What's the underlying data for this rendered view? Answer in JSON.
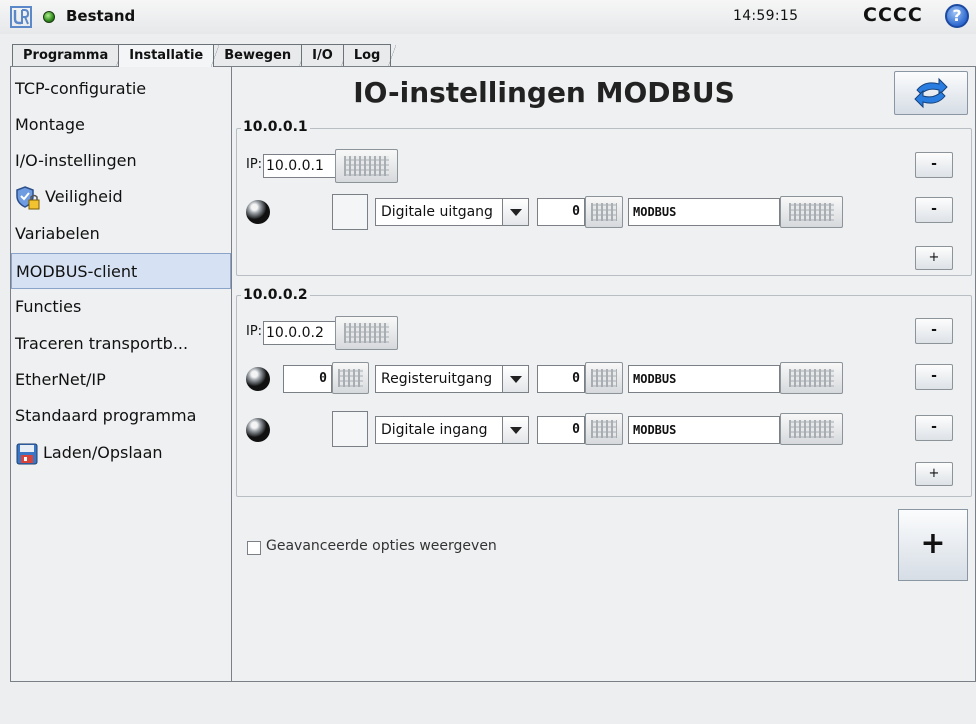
{
  "topbar": {
    "file_menu": "Bestand",
    "time": "14:59:15",
    "robot_name": "CCCC",
    "help_symbol": "?"
  },
  "tabs": [
    {
      "label": "Programma",
      "active": false
    },
    {
      "label": "Installatie",
      "active": true
    },
    {
      "label": "Bewegen",
      "active": false
    },
    {
      "label": "I/O",
      "active": false
    },
    {
      "label": "Log",
      "active": false
    }
  ],
  "sidebar": {
    "items": [
      {
        "label": "TCP-configuratie",
        "selected": false
      },
      {
        "label": "Montage",
        "selected": false
      },
      {
        "label": "I/O-instellingen",
        "selected": false
      },
      {
        "label": "Veiligheid",
        "selected": false,
        "icon": "shield-lock-icon"
      },
      {
        "label": "Variabelen",
        "selected": false
      },
      {
        "label": "MODBUS-client",
        "selected": true
      },
      {
        "label": "Functies",
        "selected": false
      },
      {
        "label": "Traceren transportb...",
        "selected": false
      },
      {
        "label": "EtherNet/IP",
        "selected": false
      },
      {
        "label": "Standaard programma",
        "selected": false
      },
      {
        "label": "Laden/Opslaan",
        "selected": false,
        "icon": "floppy-disk-icon"
      }
    ]
  },
  "main": {
    "title": "IO-instellingen MODBUS",
    "units": [
      {
        "name": "10.0.0.1",
        "ip_prefix": "IP:",
        "ip": "10.0.0.1",
        "signals": [
          {
            "value": "",
            "type": "Digitale uitgang",
            "address": "0",
            "name": "MODBUS"
          }
        ]
      },
      {
        "name": "10.0.0.2",
        "ip_prefix": "IP:",
        "ip": "10.0.0.2",
        "signals": [
          {
            "value": "0",
            "type": "Registeruitgang",
            "address": "0",
            "name": "MODBUS"
          },
          {
            "value": "",
            "type": "Digitale ingang",
            "address": "0",
            "name": "MODBUS"
          }
        ]
      }
    ],
    "remove_label": "-",
    "add_label": "+",
    "advanced_label": "Geavanceerde opties weergeven",
    "advanced_checked": false,
    "add_unit_label": "+"
  }
}
